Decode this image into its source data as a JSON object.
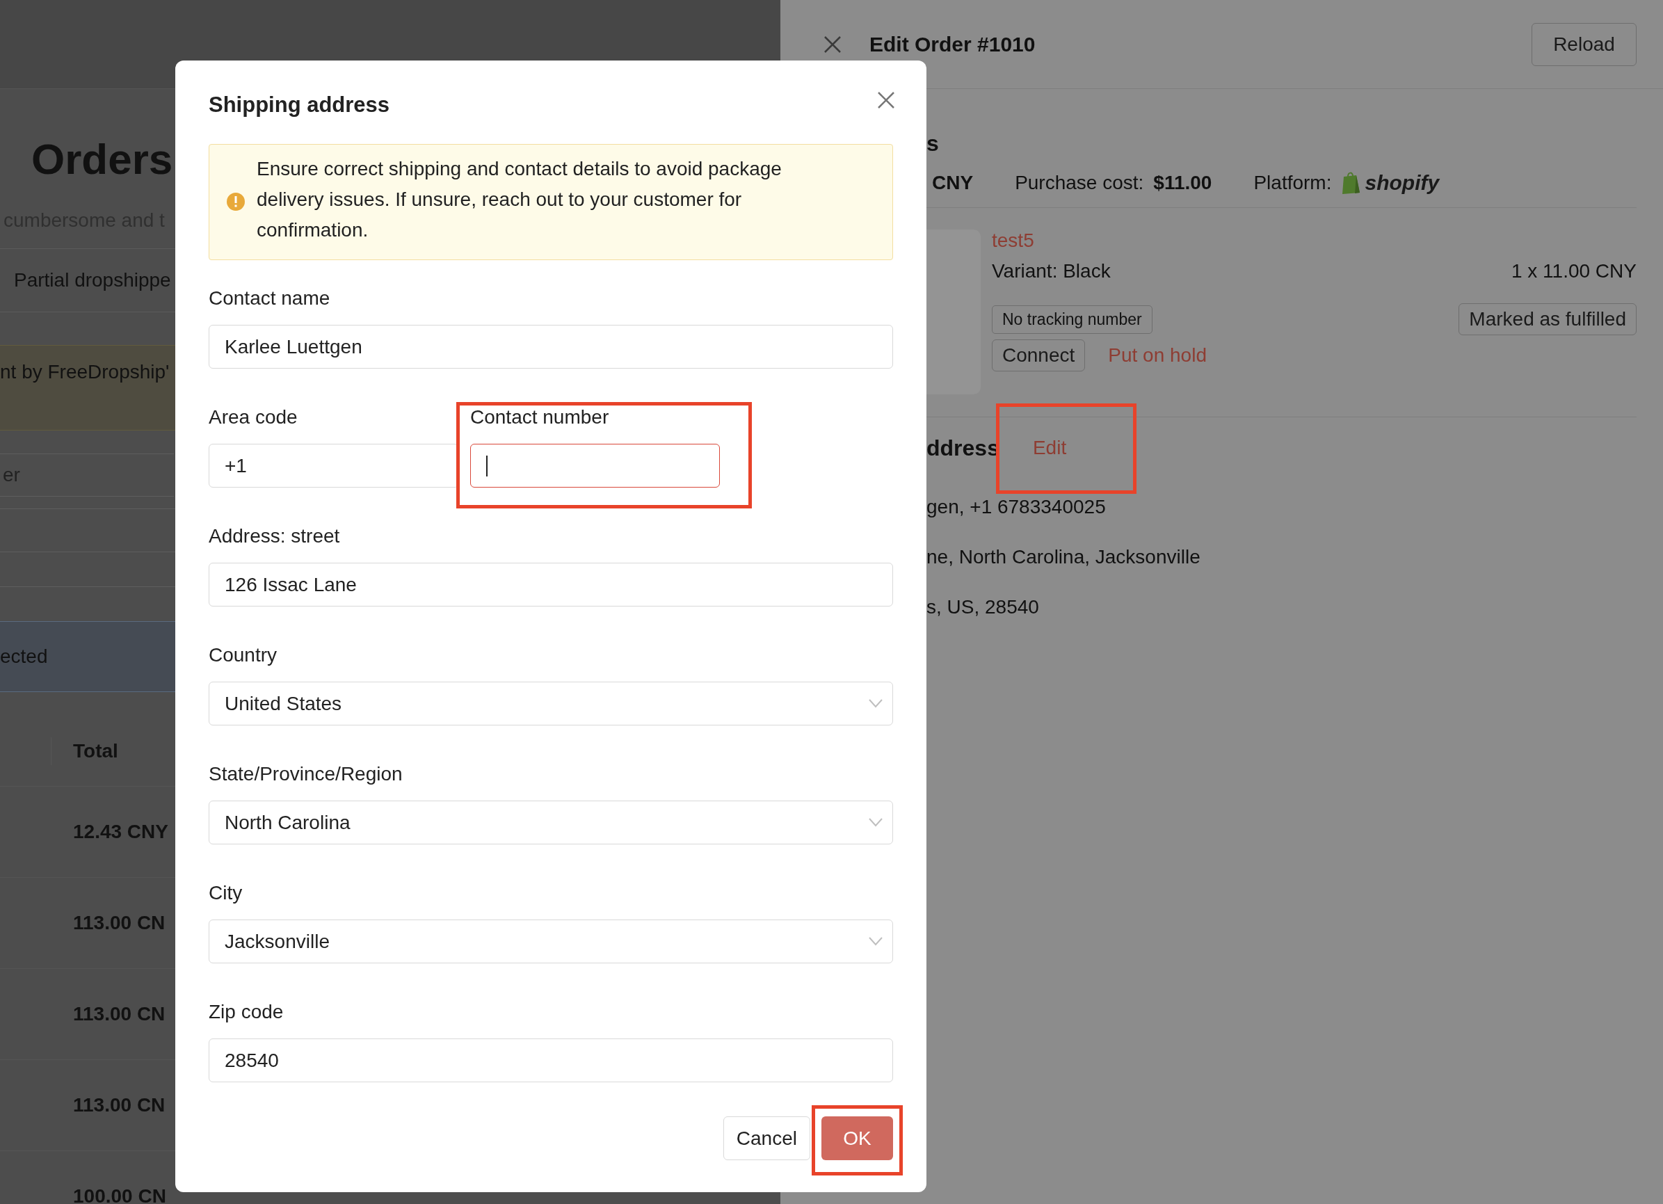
{
  "background_page": {
    "title": "Orders",
    "subtitle": "cumbersome and t",
    "tab": "Partial dropshippe",
    "notice": "nt by FreeDropship'",
    "search": {
      "placeholder": "er"
    },
    "selection_bar": "ected",
    "table": {
      "columns": [
        "Total"
      ],
      "rows": [
        "12.43 CNY",
        "113.00 CN",
        "113.00 CN",
        "113.00 CN",
        "100.00 CN"
      ]
    }
  },
  "drawer": {
    "title": "Edit Order #1010",
    "reload": "Reload",
    "section_title": "s",
    "summary": {
      "amount": "CNY",
      "purchase_label": "Purchase cost:",
      "purchase_value": "$11.00",
      "platform_label": "Platform:",
      "platform_logo": "shopify"
    },
    "item": {
      "name": "test5",
      "variant": "Variant: Black",
      "quantity_price": "1 x 11.00 CNY",
      "tracking": "No tracking number",
      "fulfillment": "Marked as fulfilled",
      "connect": "Connect",
      "hold": "Put on hold"
    },
    "address": {
      "title": "ddress",
      "edit": "Edit",
      "lines": [
        "gen, +1 6783340025",
        "ne, North Carolina, Jacksonville",
        "s, US, 28540"
      ]
    }
  },
  "modal": {
    "title": "Shipping address",
    "alert": "Ensure correct shipping and contact details to avoid package delivery issues. If unsure, reach out to your customer for confirmation.",
    "fields": [
      {
        "kind": "text",
        "label": "Contact name",
        "value": "Karlee Luettgen"
      },
      {
        "kind": "phone",
        "area_code": {
          "label": "Area code",
          "value": "+1"
        },
        "number": {
          "label": "Contact number",
          "focused": true
        }
      },
      {
        "kind": "text",
        "label": "Address: street",
        "value": "126 Issac Lane"
      },
      {
        "kind": "select",
        "label": "Country",
        "value": "United States"
      },
      {
        "kind": "select",
        "label": "State/Province/Region",
        "value": "North Carolina"
      },
      {
        "kind": "select",
        "label": "City",
        "value": "Jacksonville"
      },
      {
        "kind": "text",
        "label": "Zip code",
        "value": "28540"
      }
    ],
    "buttons": {
      "cancel": "Cancel",
      "ok": "OK"
    }
  }
}
